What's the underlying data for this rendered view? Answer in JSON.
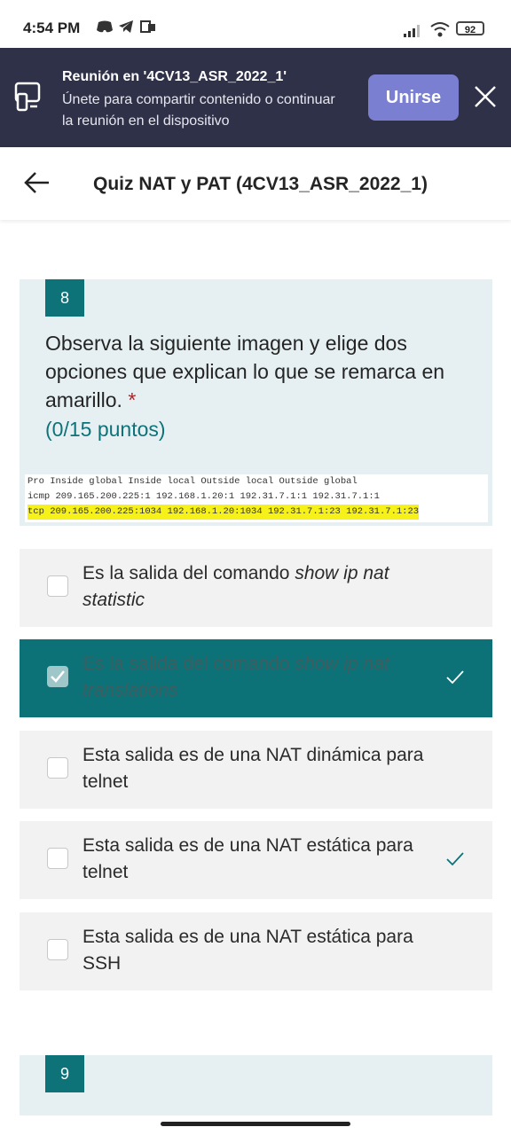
{
  "status_bar": {
    "time": "4:54 PM",
    "battery": "92"
  },
  "banner": {
    "title": "Reunión en '4CV13_ASR_2022_1'",
    "message": "Únete para compartir contenido o continuar la reunión en el dispositivo",
    "join_label": "Unirse"
  },
  "header": {
    "title": "Quiz NAT y PAT (4CV13_ASR_2022_1)"
  },
  "question": {
    "number": "8",
    "text": "Observa la siguiente imagen y elige dos opciones  que explican lo que se remarca en amarillo.",
    "required_mark": "*",
    "points": "(0/15 puntos)",
    "code_lines": [
      "Pro Inside global Inside local Outside local Outside global",
      "icmp 209.165.200.225:1 192.168.1.20:1 192.31.7.1:1 192.31.7.1:1",
      "tcp 209.165.200.225:1034 192.168.1.20:1034 192.31.7.1:23 192.31.7.1:23"
    ]
  },
  "options": [
    {
      "text_plain": "Es la salida del comando ",
      "text_italic": "show ip nat statistic",
      "selected": false,
      "correct": false
    },
    {
      "text_plain": "Es la salida del comando ",
      "text_italic": "show ip nat translations",
      "selected": true,
      "correct": true
    },
    {
      "text_plain": "Esta salida es de una NAT dinámica para telnet",
      "text_italic": "",
      "selected": false,
      "correct": false
    },
    {
      "text_plain": "Esta salida es de una NAT estática para telnet",
      "text_italic": "",
      "selected": false,
      "correct": true
    },
    {
      "text_plain": "Esta salida es de una NAT estática para SSH",
      "text_italic": "",
      "selected": false,
      "correct": false
    }
  ],
  "next_question": {
    "number": "9"
  },
  "colors": {
    "accent": "#0e7279",
    "banner": "#2f3149",
    "join_button": "#7b7fd1",
    "highlight": "#f7f11a"
  }
}
